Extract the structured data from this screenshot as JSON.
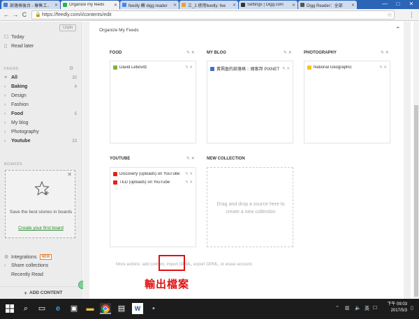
{
  "browser": {
    "tabs": [
      {
        "label": "部落格後台 - 聯售工..",
        "color": "#4a7bd0"
      },
      {
        "label": "Organize my feeds",
        "color": "#2bb24c",
        "active": true
      },
      {
        "label": "feedly 轉 digg reader",
        "color": "#4285f4"
      },
      {
        "label": "三_2.使用feedly: fee",
        "color": "#f0a030"
      },
      {
        "label": "Settings | Digg.com",
        "color": "#333333"
      },
      {
        "label": "Digg Reader：全部",
        "color": "#555555"
      }
    ],
    "url": "https://feedly.com/i/contents/edit",
    "window_controls": [
      "—",
      "□",
      "✕"
    ],
    "nav": {
      "back": "←",
      "forward": "→",
      "reload": "C"
    }
  },
  "sidebar": {
    "upgrade_label": "Urpin",
    "top_items": [
      {
        "label": "Today",
        "icon": "today-icon"
      },
      {
        "label": "Read later",
        "icon": "bookmark-icon"
      }
    ],
    "feeds_heading": "FEEDS",
    "feeds": [
      {
        "label": "All",
        "count": "32",
        "bold": true
      },
      {
        "label": "Baking",
        "count": "4",
        "bold": true
      },
      {
        "label": "Design",
        "count": ""
      },
      {
        "label": "Fashion",
        "count": ""
      },
      {
        "label": "Food",
        "count": "5",
        "bold": true
      },
      {
        "label": "My blog",
        "count": ""
      },
      {
        "label": "Photography",
        "count": ""
      },
      {
        "label": "Youtube",
        "count": "23",
        "bold": true
      }
    ],
    "boards_heading": "BOARDS",
    "board_message": "Save the best stories in boards",
    "board_link": "Create your first board",
    "integrations": "Integrations",
    "new_badge": "NEW",
    "share_collections": "Share collections",
    "recently_read": "Recently Read",
    "add_content": "ADD CONTENT"
  },
  "main": {
    "title": "Organize My Feeds",
    "collections": [
      {
        "name": "FOOD",
        "feeds": [
          {
            "label": "David Lebovitz",
            "color": "#7cb342"
          }
        ]
      },
      {
        "name": "MY BLOG",
        "feeds": [
          {
            "label": "黃珮盈的部落格 :: 癮客邦 PIXNET",
            "color": "#3f6fc8"
          }
        ]
      },
      {
        "name": "PHOTOGRAPHY",
        "feeds": [
          {
            "label": "National Geographic",
            "color": "#f5c518"
          }
        ]
      },
      {
        "name": "YOUTUBE",
        "feeds": [
          {
            "label": "Discovery (uploads) on YouTube",
            "color": "#e62117"
          },
          {
            "label": "TED (uploads) on YouTube",
            "color": "#e62117"
          }
        ]
      },
      {
        "name": "NEW COLLECTION",
        "feeds": [],
        "drop_message": "Drag and drop a source here to create a new collection"
      }
    ],
    "more_actions": "More actions: add content, import OPML, export OPML, or erase account."
  },
  "annotation": {
    "callout_text": "輸出檔案",
    "color": "#e01010"
  },
  "taskbar": {
    "clock_time": "下午 09:03",
    "clock_date": "2017/5/3"
  }
}
